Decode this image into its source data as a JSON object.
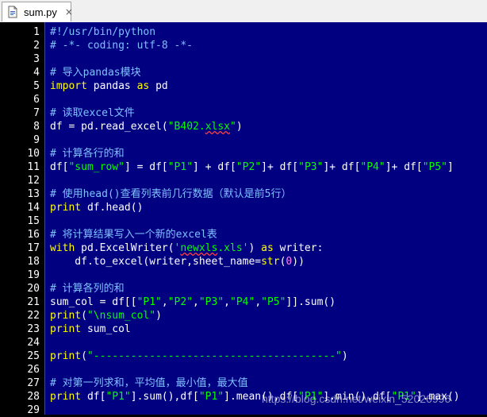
{
  "tab": {
    "label": "sum.py",
    "close": "×"
  },
  "lines": [
    {
      "n": "1",
      "segs": [
        {
          "t": "#!/usr/bin/python",
          "c": "cm"
        }
      ]
    },
    {
      "n": "2",
      "segs": [
        {
          "t": "# -*- coding: utf-8 -*-",
          "c": "cm"
        }
      ]
    },
    {
      "n": "3",
      "segs": []
    },
    {
      "n": "4",
      "segs": [
        {
          "t": "# 导入pandas模块",
          "c": "cm"
        }
      ]
    },
    {
      "n": "5",
      "segs": [
        {
          "t": "import",
          "c": "kw"
        },
        {
          "t": " pandas ",
          "c": "op"
        },
        {
          "t": "as",
          "c": "kw"
        },
        {
          "t": " pd",
          "c": "op"
        }
      ]
    },
    {
      "n": "6",
      "segs": []
    },
    {
      "n": "7",
      "segs": [
        {
          "t": "# 读取excel文件",
          "c": "cm"
        }
      ]
    },
    {
      "n": "8",
      "segs": [
        {
          "t": "df = pd.read_excel(",
          "c": "op"
        },
        {
          "t": "\"B402.",
          "c": "st"
        },
        {
          "t": "xlsx",
          "c": "st sq"
        },
        {
          "t": "\"",
          "c": "st"
        },
        {
          "t": ")",
          "c": "op"
        }
      ]
    },
    {
      "n": "9",
      "segs": []
    },
    {
      "n": "10",
      "segs": [
        {
          "t": "# 计算各行的和",
          "c": "cm"
        }
      ]
    },
    {
      "n": "11",
      "segs": [
        {
          "t": "df[",
          "c": "op"
        },
        {
          "t": "\"sum_row\"",
          "c": "st"
        },
        {
          "t": "] = df[",
          "c": "op"
        },
        {
          "t": "\"P1\"",
          "c": "st"
        },
        {
          "t": "] + df[",
          "c": "op"
        },
        {
          "t": "\"P2\"",
          "c": "st"
        },
        {
          "t": "]+ df[",
          "c": "op"
        },
        {
          "t": "\"P3\"",
          "c": "st"
        },
        {
          "t": "]+ df[",
          "c": "op"
        },
        {
          "t": "\"P4\"",
          "c": "st"
        },
        {
          "t": "]+ df[",
          "c": "op"
        },
        {
          "t": "\"P5\"",
          "c": "st"
        },
        {
          "t": "]",
          "c": "op"
        }
      ]
    },
    {
      "n": "12",
      "segs": []
    },
    {
      "n": "13",
      "segs": [
        {
          "t": "# 使用head()查看列表前几行数据（默认是前5行）",
          "c": "cm"
        }
      ]
    },
    {
      "n": "14",
      "segs": [
        {
          "t": "print",
          "c": "kw"
        },
        {
          "t": " df.head()",
          "c": "op"
        }
      ]
    },
    {
      "n": "15",
      "segs": []
    },
    {
      "n": "16",
      "segs": [
        {
          "t": "# 将计算结果写入一个新的excel表",
          "c": "cm"
        }
      ]
    },
    {
      "n": "17",
      "segs": [
        {
          "t": "with",
          "c": "kw"
        },
        {
          "t": " pd.ExcelWriter(",
          "c": "op"
        },
        {
          "t": "'",
          "c": "st"
        },
        {
          "t": "newxls",
          "c": "st sq"
        },
        {
          "t": ".xls'",
          "c": "st"
        },
        {
          "t": ") ",
          "c": "op"
        },
        {
          "t": "as",
          "c": "kw"
        },
        {
          "t": " writer:",
          "c": "op"
        }
      ]
    },
    {
      "n": "18",
      "segs": [
        {
          "t": "    df.to_excel(writer,sheet_name=",
          "c": "op"
        },
        {
          "t": "str",
          "c": "kw"
        },
        {
          "t": "(",
          "c": "op"
        },
        {
          "t": "0",
          "c": "nm"
        },
        {
          "t": "))",
          "c": "op"
        }
      ]
    },
    {
      "n": "19",
      "segs": []
    },
    {
      "n": "20",
      "segs": [
        {
          "t": "# 计算各列的和",
          "c": "cm"
        }
      ]
    },
    {
      "n": "21",
      "segs": [
        {
          "t": "sum_col = df[[",
          "c": "op"
        },
        {
          "t": "\"P1\"",
          "c": "st"
        },
        {
          "t": ",",
          "c": "op"
        },
        {
          "t": "\"P2\"",
          "c": "st"
        },
        {
          "t": ",",
          "c": "op"
        },
        {
          "t": "\"P3\"",
          "c": "st"
        },
        {
          "t": ",",
          "c": "op"
        },
        {
          "t": "\"P4\"",
          "c": "st"
        },
        {
          "t": ",",
          "c": "op"
        },
        {
          "t": "\"P5\"",
          "c": "st"
        },
        {
          "t": "]].sum()",
          "c": "op"
        }
      ]
    },
    {
      "n": "22",
      "segs": [
        {
          "t": "print",
          "c": "kw"
        },
        {
          "t": "(",
          "c": "op"
        },
        {
          "t": "\"\\nsum_col\"",
          "c": "st"
        },
        {
          "t": ")",
          "c": "op"
        }
      ]
    },
    {
      "n": "23",
      "segs": [
        {
          "t": "print",
          "c": "kw"
        },
        {
          "t": " sum_col",
          "c": "op"
        }
      ]
    },
    {
      "n": "24",
      "segs": []
    },
    {
      "n": "25",
      "segs": [
        {
          "t": "print",
          "c": "kw"
        },
        {
          "t": "(",
          "c": "op"
        },
        {
          "t": "\"---------------------------------------\"",
          "c": "st"
        },
        {
          "t": ")",
          "c": "op"
        }
      ]
    },
    {
      "n": "26",
      "segs": []
    },
    {
      "n": "27",
      "segs": [
        {
          "t": "# 对第一列求和，平均值，最小值，最大值",
          "c": "cm"
        }
      ]
    },
    {
      "n": "28",
      "segs": [
        {
          "t": "print",
          "c": "kw"
        },
        {
          "t": " df[",
          "c": "op"
        },
        {
          "t": "\"P1\"",
          "c": "st"
        },
        {
          "t": "].sum(),df[",
          "c": "op"
        },
        {
          "t": "\"P1\"",
          "c": "st"
        },
        {
          "t": "].mean(),df[",
          "c": "op"
        },
        {
          "t": "\"P1\"",
          "c": "st"
        },
        {
          "t": "].min(),df[",
          "c": "op"
        },
        {
          "t": "\"P1\"",
          "c": "st"
        },
        {
          "t": "].max()",
          "c": "op"
        }
      ]
    },
    {
      "n": "29",
      "segs": []
    }
  ],
  "watermark": "https://blog.csdn.net/weixin_52026996",
  "colors": {
    "background": "#000080",
    "gutter": "#000000",
    "comment": "#80c0ff",
    "keyword": "#ffff00",
    "string": "#00ff00",
    "number": "#ff80ff",
    "text": "#ffffff"
  }
}
